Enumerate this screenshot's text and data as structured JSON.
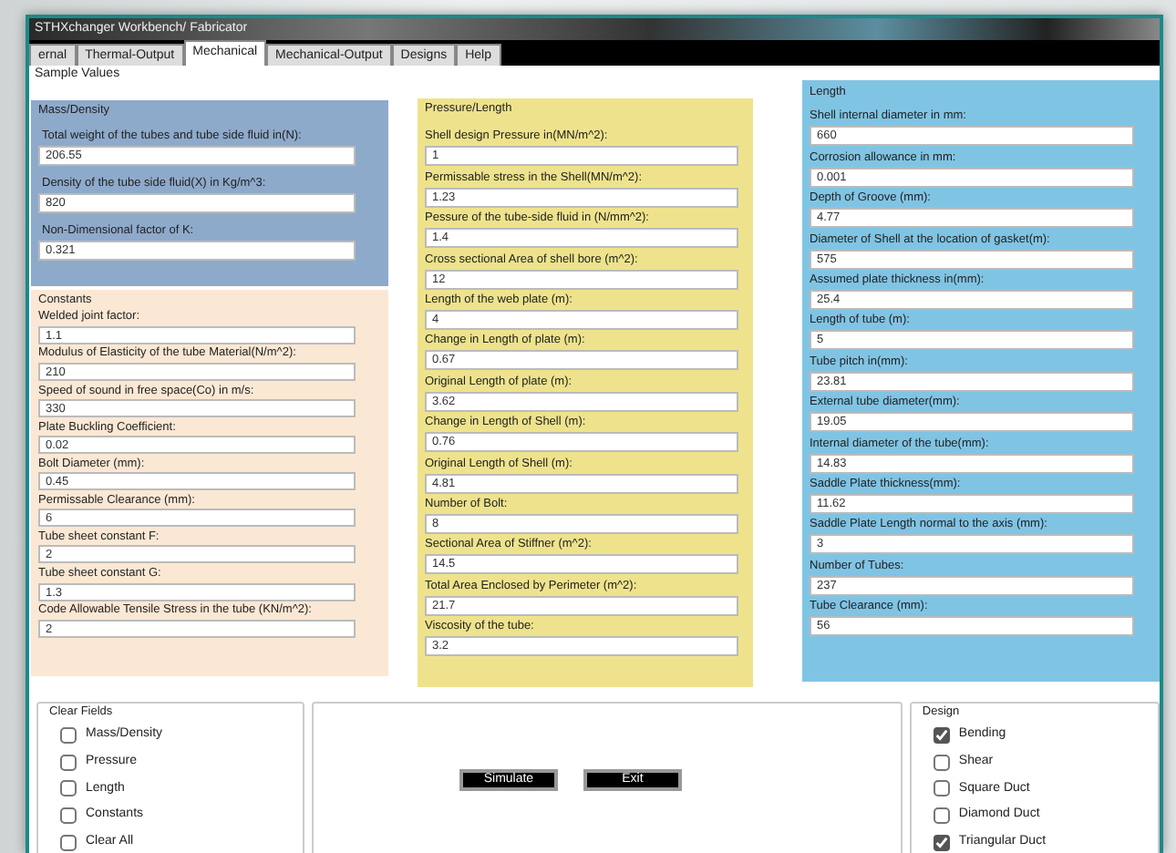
{
  "window": {
    "title": "STHXchanger Workbench/ Fabricator"
  },
  "tabs": [
    {
      "label": "ernal",
      "selected": false
    },
    {
      "label": "Thermal-Output",
      "selected": false
    },
    {
      "label": "Mechanical",
      "selected": true
    },
    {
      "label": "Mechanical-Output",
      "selected": false
    },
    {
      "label": "Designs",
      "selected": false
    },
    {
      "label": "Help",
      "selected": false
    }
  ],
  "section_label": "Sample Values",
  "mass_density": {
    "title": "Mass/Density",
    "fields": [
      {
        "label": "Total weight of the tubes and tube side fluid in(N):",
        "value": "206.55"
      },
      {
        "label": "Density of the tube side fluid(X) in Kg/m^3:",
        "value": "820"
      },
      {
        "label": "Non-Dimensional factor of K:",
        "value": "0.321"
      }
    ]
  },
  "constants": {
    "title": "Constants",
    "fields": [
      {
        "label": "Welded joint factor:",
        "value": "1.1"
      },
      {
        "label": "Modulus of Elasticity of the tube Material(N/m^2):",
        "value": "210"
      },
      {
        "label": "Speed of sound in free space(Co) in m/s:",
        "value": "330"
      },
      {
        "label": "Plate Buckling Coefficient:",
        "value": "0.02"
      },
      {
        "label": "Bolt Diameter (mm):",
        "value": "0.45"
      },
      {
        "label": "Permissable Clearance (mm):",
        "value": "6"
      },
      {
        "label": "Tube sheet constant F:",
        "value": "2"
      },
      {
        "label": "Tube sheet constant G:",
        "value": "1.3"
      },
      {
        "label": "Code Allowable Tensile Stress in the tube (KN/m^2):",
        "value": "2"
      }
    ]
  },
  "pressure_length": {
    "title": "Pressure/Length",
    "fields": [
      {
        "label": "Shell design Pressure in(MN/m^2):",
        "value": "1"
      },
      {
        "label": "Permissable stress in the Shell(MN/m^2):",
        "value": "1.23"
      },
      {
        "label": "Pessure of the tube-side fluid in (N/mm^2):",
        "value": "1.4"
      },
      {
        "label": "Cross sectional Area of shell bore (m^2):",
        "value": "12"
      },
      {
        "label": "Length of the web plate (m):",
        "value": "4"
      },
      {
        "label": "Change in Length of plate (m):",
        "value": "0.67"
      },
      {
        "label": "Original Length of plate (m):",
        "value": "3.62"
      },
      {
        "label": "Change in Length of Shell (m):",
        "value": "0.76"
      },
      {
        "label": "Original Length of Shell (m):",
        "value": "4.81"
      },
      {
        "label": "Number of Bolt:",
        "value": "8"
      },
      {
        "label": "Sectional Area of Stiffner (m^2):",
        "value": "14.5"
      },
      {
        "label": "Total Area Enclosed by Perimeter (m^2):",
        "value": "21.7"
      },
      {
        "label": "Viscosity of the tube:",
        "value": "3.2"
      }
    ]
  },
  "length": {
    "title": "Length",
    "fields": [
      {
        "label": "Shell internal diameter in mm:",
        "value": "660"
      },
      {
        "label": "Corrosion allowance in mm:",
        "value": "0.001"
      },
      {
        "label": "Depth of Groove (mm):",
        "value": "4.77"
      },
      {
        "label": "Diameter of Shell at the location of gasket(m):",
        "value": "575"
      },
      {
        "label": "Assumed plate thickness in(mm):",
        "value": "25.4"
      },
      {
        "label": "Length of tube (m):",
        "value": "5"
      },
      {
        "label": "Tube pitch in(mm):",
        "value": "23.81"
      },
      {
        "label": "External tube diameter(mm):",
        "value": "19.05"
      },
      {
        "label": "Internal diameter of the tube(mm):",
        "value": "14.83"
      },
      {
        "label": "Saddle Plate thickness(mm):",
        "value": "11.62"
      },
      {
        "label": "Saddle Plate Length normal to the axis (mm):",
        "value": "3"
      },
      {
        "label": "Number of Tubes:",
        "value": "237"
      },
      {
        "label": "Tube Clearance (mm):",
        "value": "56"
      }
    ]
  },
  "clear_fields": {
    "title": "Clear Fields",
    "options": [
      {
        "label": "Mass/Density",
        "checked": false
      },
      {
        "label": "Pressure",
        "checked": false
      },
      {
        "label": "Length",
        "checked": false
      },
      {
        "label": "Constants",
        "checked": false
      },
      {
        "label": "Clear All",
        "checked": false
      }
    ]
  },
  "buttons": [
    "Simulate",
    "Exit"
  ],
  "design": {
    "title": "Design",
    "options": [
      {
        "label": "Bending",
        "checked": true
      },
      {
        "label": "Shear",
        "checked": false
      },
      {
        "label": "Square Duct",
        "checked": false
      },
      {
        "label": "Diamond Duct",
        "checked": false
      },
      {
        "label": "Triangular Duct",
        "checked": true
      }
    ]
  }
}
